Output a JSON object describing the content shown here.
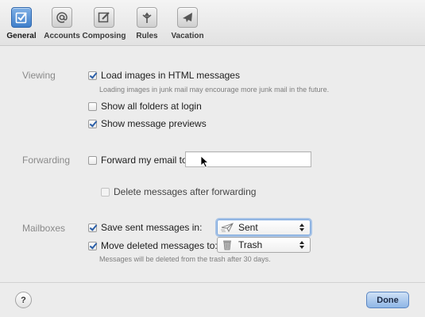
{
  "toolbar": {
    "items": [
      {
        "label": "General",
        "icon": "general-checkbox-icon",
        "selected": true
      },
      {
        "label": "Accounts",
        "icon": "at-sign-icon",
        "selected": false
      },
      {
        "label": "Composing",
        "icon": "compose-pencil-icon",
        "selected": false
      },
      {
        "label": "Rules",
        "icon": "rules-arrows-icon",
        "selected": false
      },
      {
        "label": "Vacation",
        "icon": "airplane-icon",
        "selected": false
      }
    ]
  },
  "viewing": {
    "section_label": "Viewing",
    "load_images_label": "Load images in HTML messages",
    "load_images_checked": true,
    "load_images_note": "Loading images in junk mail may encourage more junk mail in the future.",
    "show_folders_label": "Show all folders at login",
    "show_folders_checked": false,
    "show_previews_label": "Show message previews",
    "show_previews_checked": true
  },
  "forwarding": {
    "section_label": "Forwarding",
    "forward_label": "Forward my email to:",
    "forward_checked": false,
    "forward_address": "",
    "delete_after_label": "Delete messages after forwarding",
    "delete_after_checked": false,
    "delete_after_enabled": false
  },
  "mailboxes": {
    "section_label": "Mailboxes",
    "save_sent_label": "Save sent messages in:",
    "save_sent_checked": true,
    "save_sent_value": "Sent",
    "move_deleted_label": "Move deleted messages to:",
    "move_deleted_checked": true,
    "move_deleted_value": "Trash",
    "trash_note": "Messages will be deleted from the trash after 30 days."
  },
  "footer": {
    "help_label": "?",
    "done_label": "Done"
  },
  "colors": {
    "accent": "#3f7fca",
    "section_label": "#8a8a8a",
    "background": "#ececec"
  }
}
